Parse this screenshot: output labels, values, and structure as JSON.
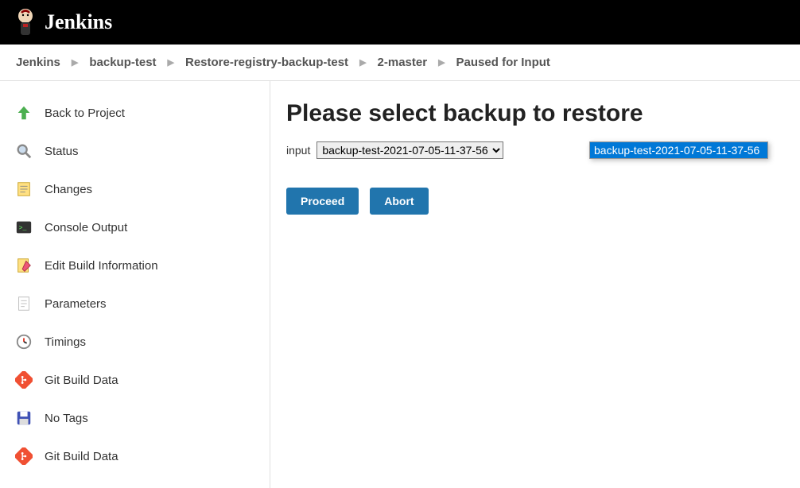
{
  "header": {
    "brand": "Jenkins"
  },
  "breadcrumb": {
    "items": [
      "Jenkins",
      "backup-test",
      "Restore-registry-backup-test",
      "2-master",
      "Paused for Input"
    ]
  },
  "sidebar": {
    "items": [
      {
        "label": "Back to Project",
        "icon": "arrow-up-icon"
      },
      {
        "label": "Status",
        "icon": "search-icon"
      },
      {
        "label": "Changes",
        "icon": "notepad-icon"
      },
      {
        "label": "Console Output",
        "icon": "terminal-icon"
      },
      {
        "label": "Edit Build Information",
        "icon": "edit-icon"
      },
      {
        "label": "Parameters",
        "icon": "document-icon"
      },
      {
        "label": "Timings",
        "icon": "clock-icon"
      },
      {
        "label": "Git Build Data",
        "icon": "git-icon"
      },
      {
        "label": "No Tags",
        "icon": "save-icon"
      },
      {
        "label": "Git Build Data",
        "icon": "git-icon"
      }
    ]
  },
  "main": {
    "title": "Please select backup to restore",
    "input_label": "input",
    "select_value": "backup-test-2021-07-05-11-37-56",
    "dropdown_options": [
      "backup-test-2021-07-05-11-37-56"
    ],
    "proceed_label": "Proceed",
    "abort_label": "Abort"
  }
}
